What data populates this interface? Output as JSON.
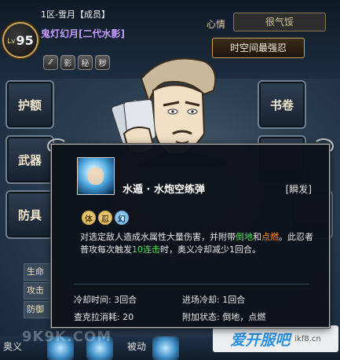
{
  "player": {
    "level_prefix": "Lv",
    "level": "95",
    "server_line": "1区-雪月【成员】",
    "name": "鬼灯幻月[二代水影]"
  },
  "mini_icons": [
    "⁄⁄",
    "影",
    "秘",
    "秽"
  ],
  "mood": {
    "label": "心情",
    "value": "很气馁"
  },
  "title_button": "时空间最强忍",
  "left_slots": [
    "护额",
    "武器",
    "防具"
  ],
  "right_slots": [
    "书卷"
  ],
  "stats_panel": {
    "labels": [
      "生命",
      "攻击",
      "防御"
    ]
  },
  "bottom_text": {
    "left": "奥义",
    "middle": "被动"
  },
  "watermark": "9K9K.COM",
  "site_logo": {
    "big": "爱开服吧",
    "small": "ikf8.cn"
  },
  "tooltip": {
    "skill_name": "水遁 · 水炮空练弹",
    "skill_type": "[瞬发]",
    "chakra": [
      "体",
      "忍",
      "幻"
    ],
    "description": {
      "p1": "对选定敌人造成水属性大量伤害，并附带",
      "hl1": "倒地",
      "p2": "和",
      "hl2": "点燃",
      "p3": "。此忍者普攻每次触发",
      "hl3": "10连击",
      "p4": "时，奥义冷却减少1回合。"
    },
    "stats": {
      "cooldown": "冷却时间: 3回合",
      "entry_cooldown": "进场冷却: 1回合",
      "chakra_cost": "查克拉消耗: 20",
      "extra_status": "附加状态: 倒地，点燃"
    }
  },
  "colors": {
    "tooltip_bg": "#0c121a",
    "name_purple": "#c59bff",
    "highlight_green": "#5fd86b",
    "highlight_orange": "#ff8c2a",
    "gold": "#c8a55a"
  }
}
